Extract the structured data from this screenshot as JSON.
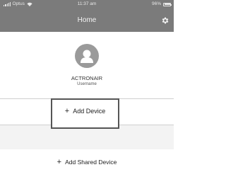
{
  "status_bar": {
    "carrier": "Optus",
    "time": "11:37 am",
    "battery": "96%"
  },
  "nav": {
    "title": "Home",
    "settings_icon": "gear-icon"
  },
  "profile": {
    "name": "ACTRONAIR",
    "label": "Username",
    "avatar_icon": "user-icon"
  },
  "actions": {
    "add_device_label": "Add Device",
    "add_shared_device_label": "Add Shared Device",
    "plus_symbol": "+"
  },
  "colors": {
    "header": "#7b7b7b",
    "avatar": "#9a9a9a",
    "band": "#f3f3f3"
  }
}
